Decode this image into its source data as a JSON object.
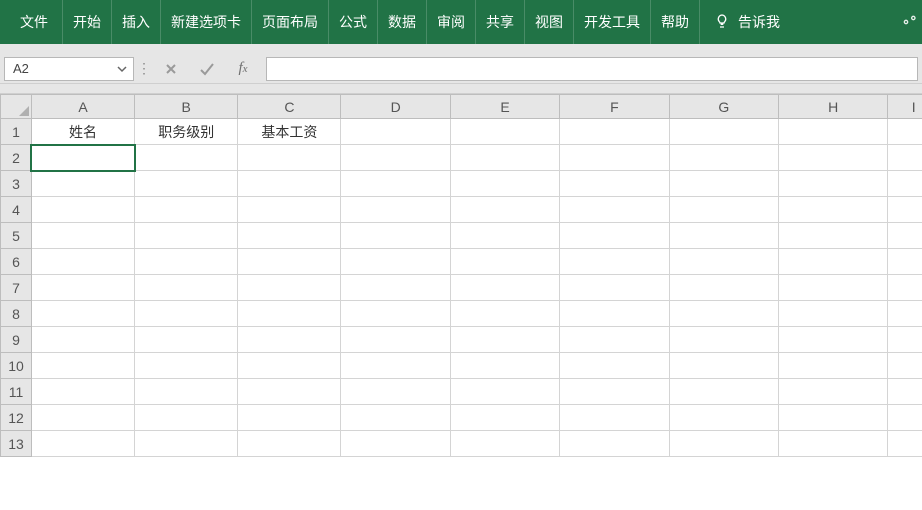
{
  "ribbon": {
    "tabs": [
      "文件",
      "开始",
      "插入",
      "新建选项卡",
      "页面布局",
      "公式",
      "数据",
      "审阅",
      "共享",
      "视图",
      "开发工具",
      "帮助"
    ],
    "tell_me": "告诉我"
  },
  "formula_bar": {
    "name_box": "A2",
    "formula": ""
  },
  "grid": {
    "columns": [
      "A",
      "B",
      "C",
      "D",
      "E",
      "F",
      "G",
      "H",
      "I"
    ],
    "row_count": 13,
    "active_cell": {
      "row": 2,
      "col": 0
    },
    "cells": {
      "r1": {
        "A": "姓名",
        "B": "职务级别",
        "C": "基本工资"
      }
    }
  }
}
